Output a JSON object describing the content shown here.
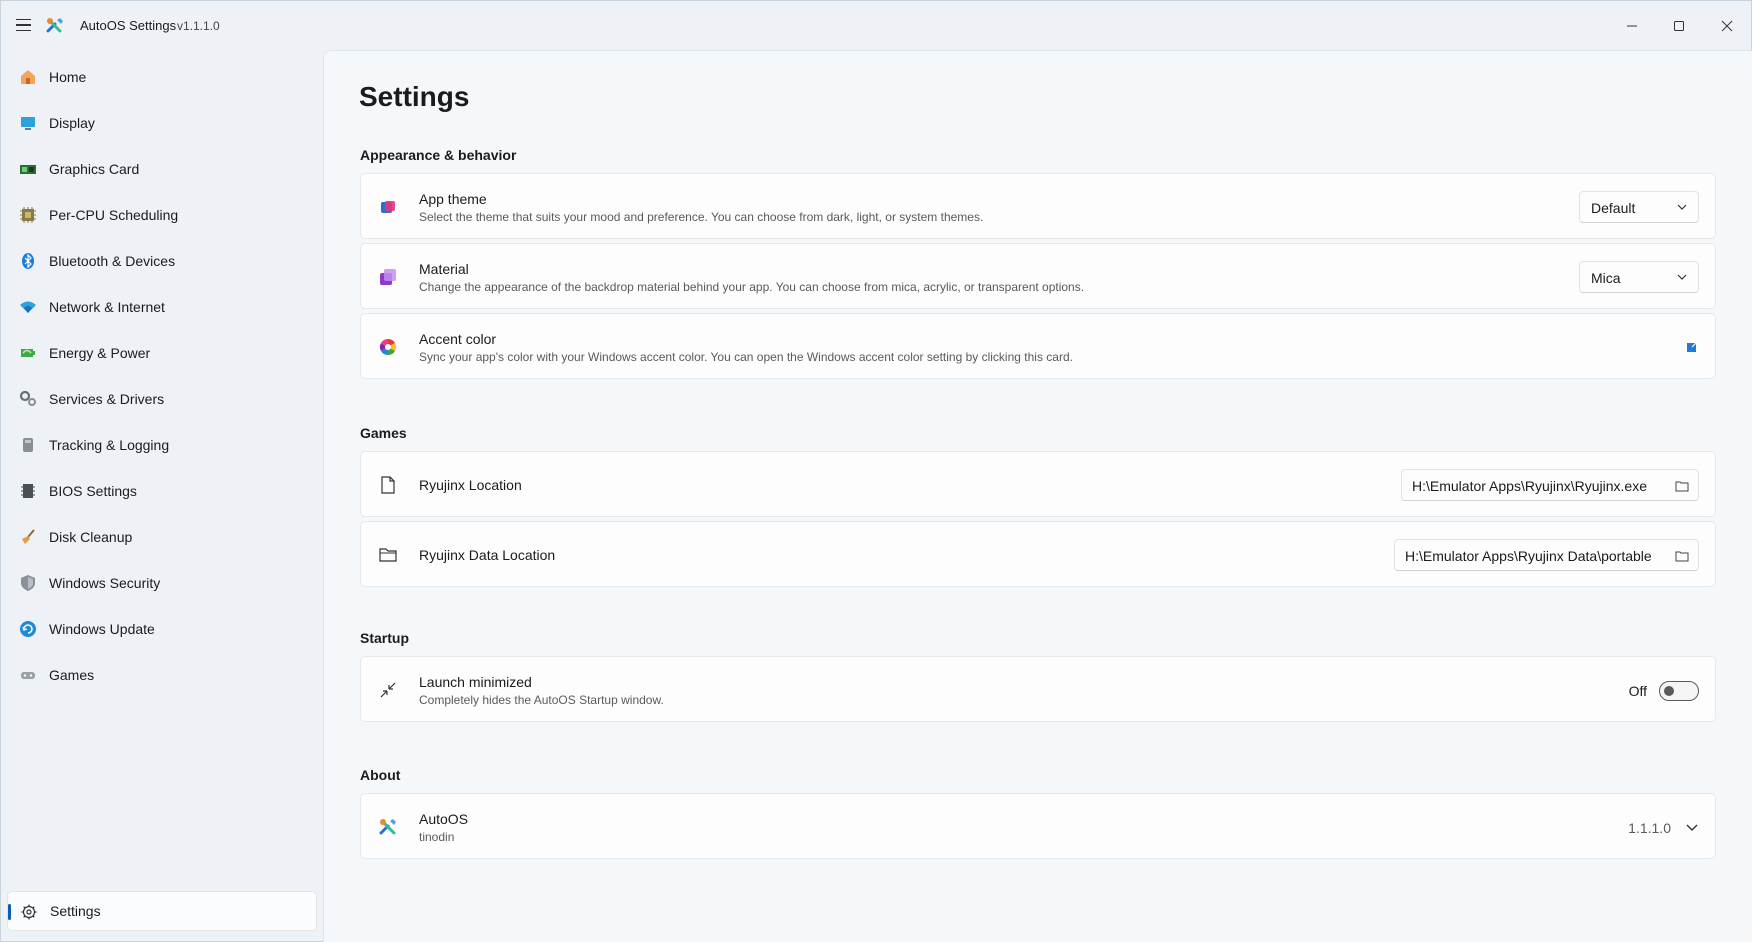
{
  "window": {
    "title": "AutoOS Settings",
    "version": "v1.1.1.0"
  },
  "sidebar": {
    "items": [
      {
        "label": "Home",
        "icon": "home-icon"
      },
      {
        "label": "Display",
        "icon": "monitor-icon"
      },
      {
        "label": "Graphics Card",
        "icon": "graphics-card-icon"
      },
      {
        "label": "Per-CPU Scheduling",
        "icon": "cpu-icon"
      },
      {
        "label": "Bluetooth & Devices",
        "icon": "bluetooth-icon"
      },
      {
        "label": "Network & Internet",
        "icon": "wifi-icon"
      },
      {
        "label": "Energy & Power",
        "icon": "battery-icon"
      },
      {
        "label": "Services & Drivers",
        "icon": "gears-icon"
      },
      {
        "label": "Tracking & Logging",
        "icon": "tracking-icon"
      },
      {
        "label": "BIOS Settings",
        "icon": "chip-icon"
      },
      {
        "label": "Disk Cleanup",
        "icon": "broom-icon"
      },
      {
        "label": "Windows Security",
        "icon": "shield-icon"
      },
      {
        "label": "Windows Update",
        "icon": "update-icon"
      },
      {
        "label": "Games",
        "icon": "gamepad-icon"
      }
    ],
    "settings_label": "Settings"
  },
  "main": {
    "title": "Settings",
    "sections": {
      "appearance": {
        "header": "Appearance & behavior",
        "app_theme": {
          "title": "App theme",
          "description": "Select the theme that suits your mood and preference. You can choose from dark, light, or system themes.",
          "value": "Default"
        },
        "material": {
          "title": "Material",
          "description": "Change the appearance of the backdrop material behind your app. You can choose from mica, acrylic, or transparent options.",
          "value": "Mica"
        },
        "accent_color": {
          "title": "Accent color",
          "description": "Sync your app's color with your Windows accent color. You can open the Windows accent color setting by clicking this card."
        }
      },
      "games": {
        "header": "Games",
        "ryujinx_location": {
          "title": "Ryujinx Location",
          "value": "H:\\Emulator Apps\\Ryujinx\\Ryujinx.exe"
        },
        "ryujinx_data_location": {
          "title": "Ryujinx Data Location",
          "value": "H:\\Emulator Apps\\Ryujinx Data\\portable"
        }
      },
      "startup": {
        "header": "Startup",
        "launch_minimized": {
          "title": "Launch minimized",
          "description": "Completely hides the AutoOS Startup window.",
          "state": "Off"
        }
      },
      "about": {
        "header": "About",
        "app": {
          "title": "AutoOS",
          "author": "tinodin",
          "version": "1.1.1.0"
        }
      }
    }
  },
  "colors": {
    "accent": "#0a5fb4",
    "background": "#eef2f7",
    "card": "#fdfdfe"
  }
}
